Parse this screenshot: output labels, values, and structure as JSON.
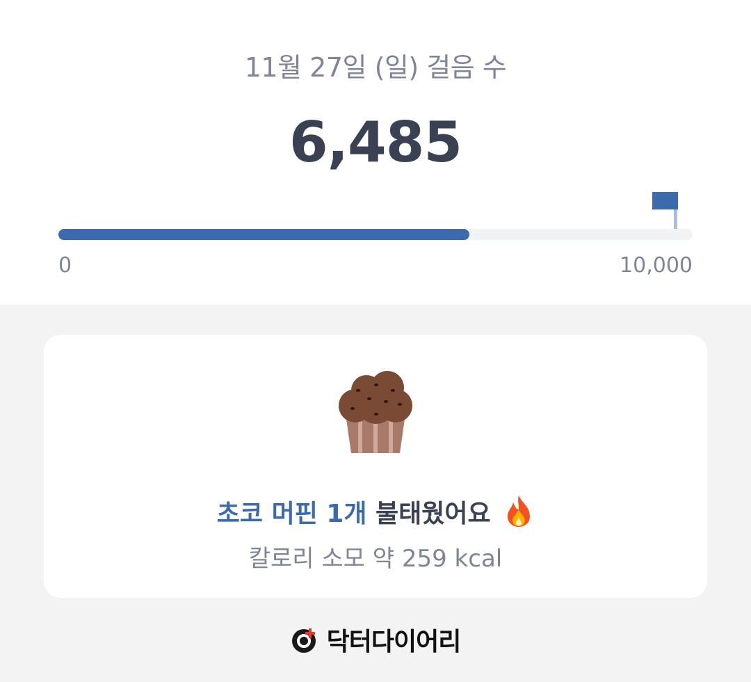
{
  "header": {
    "date_label": "11월 27일 (일) 걸음 수",
    "steps": "6,485"
  },
  "progress": {
    "value": 6485,
    "goal": 10000,
    "min_label": "0",
    "max_label": "10,000",
    "fill_color": "#3b6bad",
    "goal_flag_icon": "flag-icon"
  },
  "card": {
    "food_icon": "muffin-icon",
    "burn_highlight": "초코 머핀 1개",
    "burn_rest": " 불태웠어요",
    "burn_emoji_icon": "fire-icon",
    "calorie_text": "칼로리 소모 약 259 kcal"
  },
  "footer": {
    "logo_icon": "doctor-diary-logo-icon",
    "brand_name": "닥터다이어리"
  }
}
